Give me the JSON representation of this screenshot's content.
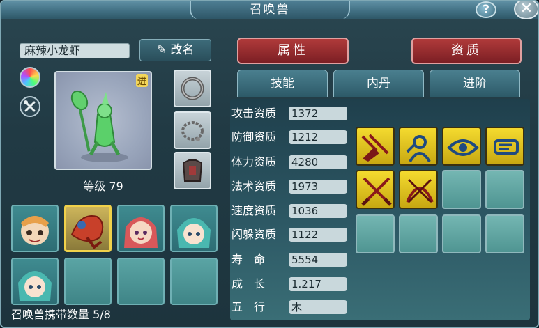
{
  "window": {
    "title": "召唤兽",
    "help_label": "?",
    "close_label": "✕"
  },
  "pet": {
    "name": "麻辣小龙虾",
    "rename_label": "改名",
    "promote_tag": "进",
    "level_text": "等级 79",
    "carry_text": "召唤兽携带数量 5/8"
  },
  "tabs": {
    "top": [
      {
        "label": "属性"
      },
      {
        "label": "资质"
      }
    ],
    "sub": [
      {
        "label": "技能"
      },
      {
        "label": "内丹"
      },
      {
        "label": "进阶"
      }
    ]
  },
  "stats": [
    {
      "label": "攻击资质",
      "value": "1372"
    },
    {
      "label": "防御资质",
      "value": "1212"
    },
    {
      "label": "体力资质",
      "value": "4280"
    },
    {
      "label": "法术资质",
      "value": "1973"
    },
    {
      "label": "速度资质",
      "value": "1036"
    },
    {
      "label": "闪躲资质",
      "value": "1122"
    },
    {
      "label": "寿　命",
      "value": "5554"
    },
    {
      "label": "成　长",
      "value": "1.217"
    },
    {
      "label": "五　行",
      "value": "木"
    }
  ],
  "skills": [
    {
      "icon": "sword-strike-icon",
      "filled": true
    },
    {
      "icon": "guardian-figure-icon",
      "filled": true
    },
    {
      "icon": "eye-icon",
      "filled": true
    },
    {
      "icon": "hand-scroll-icon",
      "filled": true
    },
    {
      "icon": "crossed-swords-icon",
      "filled": true
    },
    {
      "icon": "crossed-bows-icon",
      "filled": true
    },
    {
      "icon": "",
      "filled": false
    },
    {
      "icon": "",
      "filled": false
    },
    {
      "icon": "",
      "filled": false
    },
    {
      "icon": "",
      "filled": false
    },
    {
      "icon": "",
      "filled": false
    },
    {
      "icon": "",
      "filled": false
    }
  ],
  "colors": {
    "accent_red": "#b03a3a",
    "skill_gold": "#f4da2f",
    "panel_teal": "#2e5a66"
  }
}
